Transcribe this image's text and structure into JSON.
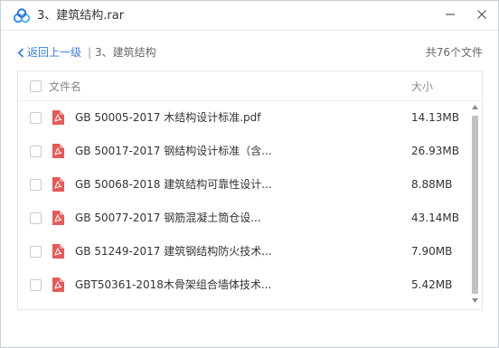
{
  "window": {
    "title": "3、建筑结构.rar",
    "icon": "cloud-app-icon",
    "accent": "#3d7fd6"
  },
  "nav": {
    "back_label": "返回上一级",
    "separator": "|",
    "current_folder": "3、建筑结构",
    "file_count": "共76个文件"
  },
  "list": {
    "columns": {
      "name": "文件名",
      "size": "大小"
    },
    "rows": [
      {
        "name": "GB 50005-2017 木结构设计标准.pdf",
        "size": "14.13MB",
        "icon": "pdf-icon"
      },
      {
        "name": "GB 50017-2017 钢结构设计标准（含...",
        "size": "26.93MB",
        "icon": "pdf-icon"
      },
      {
        "name": "GB 50068-2018 建筑结构可靠性设计...",
        "size": "8.88MB",
        "icon": "pdf-icon"
      },
      {
        "name": "GB 50077-2017  钢筋混凝土筒仓设...",
        "size": "43.14MB",
        "icon": "pdf-icon"
      },
      {
        "name": "GB 51249-2017 建筑钢结构防火技术...",
        "size": "7.90MB",
        "icon": "pdf-icon"
      },
      {
        "name": "GBT50361-2018木骨架组合墙体技术...",
        "size": "5.42MB",
        "icon": "pdf-icon"
      }
    ]
  },
  "colors": {
    "pdf_red": "#e25c5c",
    "link_blue": "#3d7fd6",
    "scroll_thumb": "#c1c1c1"
  }
}
